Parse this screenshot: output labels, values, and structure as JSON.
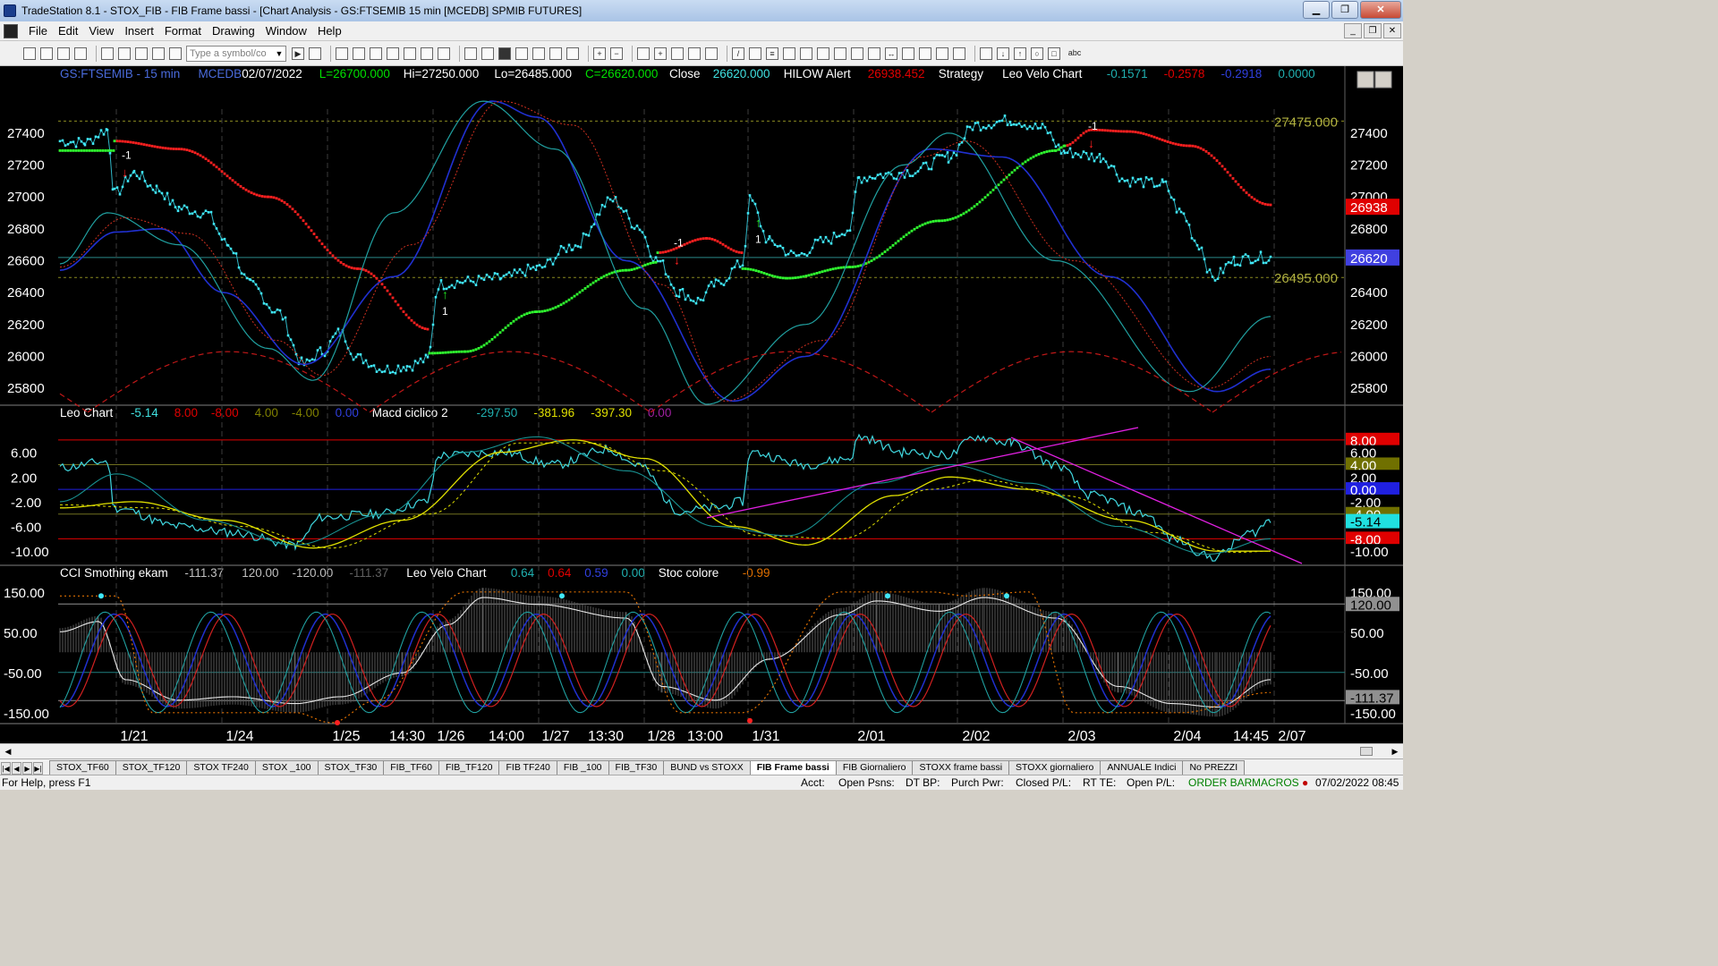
{
  "window": {
    "title": "TradeStation 8.1 - STOX_FIB - FIB Frame bassi - [Chart Analysis - GS:FTSEMIB  15 min  [MCEDB] SPMIB FUTURES]",
    "minimize": "▁",
    "maximize": "❐",
    "close": "✕"
  },
  "menu": [
    "File",
    "Edit",
    "View",
    "Insert",
    "Format",
    "Drawing",
    "Window",
    "Help"
  ],
  "toolbar": {
    "symbol_placeholder": "Type a symbol/co",
    "abc_label": "abc"
  },
  "chart": {
    "header1": [
      {
        "t": "GS:FTSEMIB - 15 min",
        "c": "#4a6bdc"
      },
      {
        "t": "MCEDB",
        "c": "#4a6bdc"
      },
      {
        "t": "02/07/2022",
        "c": "#ffffff"
      },
      {
        "t": "L=26700.000",
        "c": "#00e000"
      },
      {
        "t": "Hi=27250.000",
        "c": "#ffffff"
      },
      {
        "t": "Lo=26485.000",
        "c": "#ffffff"
      },
      {
        "t": "C=26620.000",
        "c": "#00e000"
      },
      {
        "t": "Close",
        "c": "#ffffff"
      },
      {
        "t": "26620.000",
        "c": "#40e0e0"
      },
      {
        "t": "HILOW Alert",
        "c": "#ffffff"
      },
      {
        "t": "26938.452",
        "c": "#e00000"
      },
      {
        "t": "Strategy",
        "c": "#ffffff"
      },
      {
        "t": "Leo Velo Chart",
        "c": "#ffffff"
      },
      {
        "t": "-0.1571",
        "c": "#20b0b0"
      },
      {
        "t": "-0.2578",
        "c": "#e00000"
      },
      {
        "t": "-0.2918",
        "c": "#3040e0"
      },
      {
        "t": "0.0000",
        "c": "#20b0b0"
      }
    ],
    "header2": [
      {
        "t": "Leo Chart",
        "c": "#ffffff"
      },
      {
        "t": "-5.14",
        "c": "#40e0e0"
      },
      {
        "t": "8.00",
        "c": "#e00000"
      },
      {
        "t": "-8.00",
        "c": "#e00000"
      },
      {
        "t": "4.00",
        "c": "#808000"
      },
      {
        "t": "-4.00",
        "c": "#808000"
      },
      {
        "t": "0.00",
        "c": "#3040e0"
      },
      {
        "t": "Macd ciclico 2",
        "c": "#ffffff"
      },
      {
        "t": "-297.50",
        "c": "#20b0b0"
      },
      {
        "t": "-381.96",
        "c": "#e0e000"
      },
      {
        "t": "-397.30",
        "c": "#e0e000"
      },
      {
        "t": "0.00",
        "c": "#a020a0"
      }
    ],
    "header3": [
      {
        "t": "CCI Smothing ekam",
        "c": "#ffffff"
      },
      {
        "t": "-111.37",
        "c": "#c0c0c0"
      },
      {
        "t": "120.00",
        "c": "#c0c0c0"
      },
      {
        "t": "-120.00",
        "c": "#c0c0c0"
      },
      {
        "t": "-111.37",
        "c": "#606060"
      },
      {
        "t": "Leo Velo Chart",
        "c": "#ffffff"
      },
      {
        "t": "0.64",
        "c": "#20b0b0"
      },
      {
        "t": "0.64",
        "c": "#e00000"
      },
      {
        "t": "0.59",
        "c": "#3040e0"
      },
      {
        "t": "0.00",
        "c": "#20b0b0"
      },
      {
        "t": "Stoc colore",
        "c": "#ffffff"
      },
      {
        "t": "-0.99",
        "c": "#e07000"
      }
    ],
    "price_axis": [
      "27400",
      "27200",
      "27000",
      "26800",
      "26600",
      "26400",
      "26200",
      "26000",
      "25800"
    ],
    "price_levels": {
      "upper": "27475.000",
      "lower": "26495.000"
    },
    "price_badges": [
      {
        "t": "26938",
        "bg": "#e00000",
        "c": "#ffffff"
      },
      {
        "t": "26620",
        "bg": "#4040e0",
        "c": "#ffffff"
      }
    ],
    "osc_axis": [
      "6.00",
      "2.00",
      "-2.00",
      "-6.00",
      "-10.00"
    ],
    "osc_badges": [
      {
        "t": "8.00",
        "bg": "#e00000",
        "c": "#ffffff"
      },
      {
        "t": "6.00",
        "bg": "#000000",
        "c": "#ffffff"
      },
      {
        "t": "4.00",
        "bg": "#707000",
        "c": "#ffffff"
      },
      {
        "t": "2.00",
        "bg": "#000000",
        "c": "#ffffff"
      },
      {
        "t": "0.00",
        "bg": "#2020e0",
        "c": "#ffffff"
      },
      {
        "t": "-2.00",
        "bg": "#000000",
        "c": "#ffffff"
      },
      {
        "t": "-4.00",
        "bg": "#707000",
        "c": "#ffffff"
      },
      {
        "t": "-5.14",
        "bg": "#20e0e0",
        "c": "#000000"
      },
      {
        "t": "-8.00",
        "bg": "#e00000",
        "c": "#ffffff"
      },
      {
        "t": "-10.00",
        "bg": "#000000",
        "c": "#ffffff"
      }
    ],
    "cci_axis": [
      "150.00",
      "50.00",
      "-50.00",
      "-150.00"
    ],
    "cci_badges": [
      {
        "t": "150.00",
        "bg": "#000000",
        "c": "#ffffff"
      },
      {
        "t": "120.00",
        "bg": "#909090",
        "c": "#000000"
      },
      {
        "t": "50.00",
        "bg": "#000000",
        "c": "#ffffff"
      },
      {
        "t": "-50.00",
        "bg": "#000000",
        "c": "#ffffff"
      },
      {
        "t": "-111.37",
        "bg": "#909090",
        "c": "#000000"
      },
      {
        "t": "-150.00",
        "bg": "#000000",
        "c": "#ffffff"
      }
    ],
    "time_labels": [
      "1/21",
      "1/24",
      "1/25",
      "14:30",
      "1/26",
      "14:00",
      "1/27",
      "13:30",
      "1/28",
      "13:00",
      "1/31",
      "2/01",
      "2/02",
      "2/03",
      "2/04",
      "14:45",
      "2/07"
    ],
    "signals": [
      {
        "label": "-1",
        "dir": "down"
      },
      {
        "label": "1",
        "dir": "up"
      },
      {
        "label": "-1",
        "dir": "down"
      },
      {
        "label": "1",
        "dir": "up"
      },
      {
        "label": "-1",
        "dir": "down"
      }
    ]
  },
  "tabs": [
    "STOX_TF60",
    "STOX_TF120",
    "STOX TF240",
    "STOX _100",
    "STOX_TF30",
    "FIB_TF60",
    "FIB_TF120",
    "FIB TF240",
    "FIB _100",
    "FIB_TF30",
    "BUND vs STOXX",
    "FIB Frame bassi",
    "FIB Giornaliero",
    "STOXX frame bassi",
    "STOXX giornaliero",
    "ANNUALE Indici",
    "No PREZZI"
  ],
  "active_tab": "FIB Frame bassi",
  "status": {
    "help": "For Help, press F1",
    "acct": "Acct:",
    "open_psns": "Open Psns:",
    "dt_bp": "DT BP:",
    "purch_pwr": "Purch Pwr:",
    "closed_pl": "Closed P/L:",
    "rt_te": "RT TE:",
    "open_pl": "Open P/L:",
    "order_bar": "ORDER BAR",
    "macros": "MACROS",
    "datetime": "07/02/2022 08:45"
  }
}
